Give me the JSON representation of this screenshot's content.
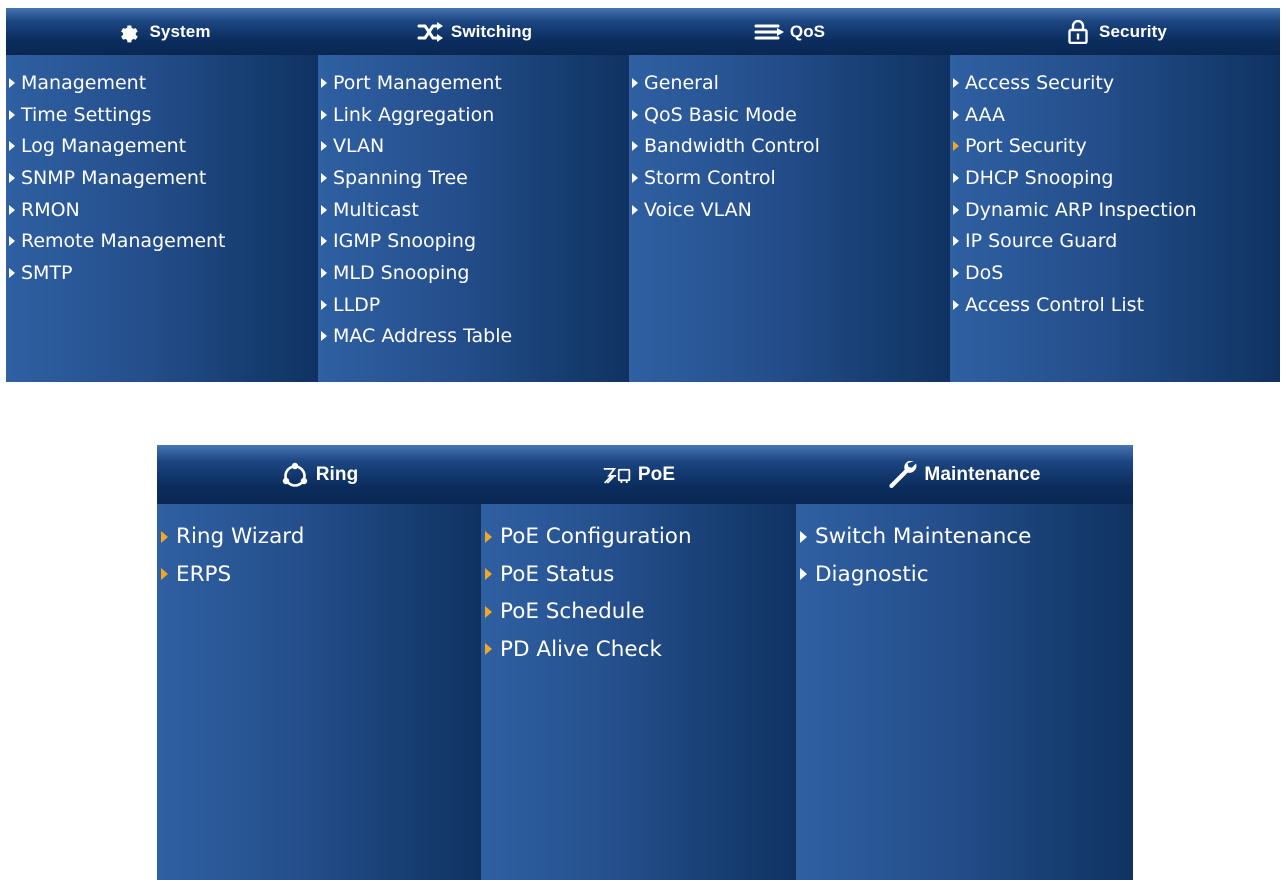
{
  "colors": {
    "panel_light": "#2f60a2",
    "panel_dark": "#0f3262",
    "header_dark": "#0b2d5e",
    "text": "#ffffff",
    "arrow_default": "#ffffff",
    "arrow_highlight": "#f5a623"
  },
  "menu_top": {
    "columns": [
      {
        "title": "System",
        "icon": "gear-icon",
        "items": [
          {
            "label": "Management",
            "arrow": "white"
          },
          {
            "label": "Time Settings",
            "arrow": "white"
          },
          {
            "label": "Log Management",
            "arrow": "white"
          },
          {
            "label": "SNMP Management",
            "arrow": "white"
          },
          {
            "label": "RMON",
            "arrow": "white"
          },
          {
            "label": "Remote Management",
            "arrow": "white"
          },
          {
            "label": "SMTP",
            "arrow": "white"
          }
        ]
      },
      {
        "title": "Switching",
        "icon": "switching-arrows-icon",
        "items": [
          {
            "label": "Port Management",
            "arrow": "white"
          },
          {
            "label": "Link Aggregation",
            "arrow": "white"
          },
          {
            "label": "VLAN",
            "arrow": "white"
          },
          {
            "label": "Spanning Tree",
            "arrow": "white"
          },
          {
            "label": "Multicast",
            "arrow": "white"
          },
          {
            "label": "IGMP Snooping",
            "arrow": "white"
          },
          {
            "label": "MLD Snooping",
            "arrow": "white"
          },
          {
            "label": "LLDP",
            "arrow": "white"
          },
          {
            "label": "MAC Address Table",
            "arrow": "white"
          }
        ]
      },
      {
        "title": "QoS",
        "icon": "qos-lines-icon",
        "items": [
          {
            "label": "General",
            "arrow": "white"
          },
          {
            "label": "QoS Basic Mode",
            "arrow": "white"
          },
          {
            "label": "Bandwidth Control",
            "arrow": "white"
          },
          {
            "label": "Storm Control",
            "arrow": "white"
          },
          {
            "label": "Voice VLAN",
            "arrow": "white"
          }
        ]
      },
      {
        "title": "Security",
        "icon": "padlock-icon",
        "items": [
          {
            "label": "Access Security",
            "arrow": "white"
          },
          {
            "label": "AAA",
            "arrow": "white"
          },
          {
            "label": "Port Security",
            "arrow": "orange"
          },
          {
            "label": "DHCP Snooping",
            "arrow": "white"
          },
          {
            "label": "Dynamic ARP Inspection",
            "arrow": "white"
          },
          {
            "label": "IP Source Guard",
            "arrow": "white"
          },
          {
            "label": "DoS",
            "arrow": "white"
          },
          {
            "label": "Access Control List",
            "arrow": "white"
          }
        ]
      }
    ]
  },
  "menu_bottom": {
    "columns": [
      {
        "title": "Ring",
        "icon": "ring-icon",
        "items": [
          {
            "label": "Ring Wizard",
            "arrow": "orange"
          },
          {
            "label": "ERPS",
            "arrow": "orange"
          }
        ]
      },
      {
        "title": "PoE",
        "icon": "poe-plug-icon",
        "items": [
          {
            "label": "PoE Configuration",
            "arrow": "orange"
          },
          {
            "label": "PoE Status",
            "arrow": "orange"
          },
          {
            "label": "PoE Schedule",
            "arrow": "orange"
          },
          {
            "label": "PD Alive Check",
            "arrow": "orange"
          }
        ]
      },
      {
        "title": "Maintenance",
        "icon": "wrench-icon",
        "items": [
          {
            "label": "Switch Maintenance",
            "arrow": "white"
          },
          {
            "label": "Diagnostic",
            "arrow": "white"
          }
        ]
      }
    ]
  }
}
